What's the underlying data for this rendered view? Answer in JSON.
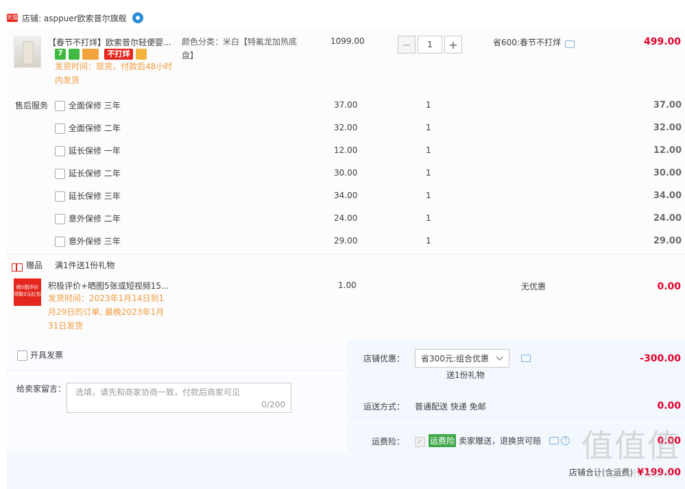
{
  "shop": {
    "badge": "天猫",
    "label": "店铺: asppuer欧索普尔旗舰"
  },
  "product": {
    "title": "【春节不打烊】欧索普尔轻便婴...",
    "badge_text": "不打烊",
    "badge_seven": "7",
    "ship_time": "发货时间：现货，付款后48小时内发货",
    "sku": "颜色分类：米白【特氟龙加热底盘】",
    "unit_price": "1099.00",
    "quantity": "1",
    "discount": "省600:春节不打烊",
    "total": "499.00"
  },
  "services": {
    "heading": "售后服务",
    "items": [
      {
        "label": "全面保修 三年",
        "price": "37.00",
        "qty": "1",
        "total": "37.00"
      },
      {
        "label": "全面保修 二年",
        "price": "32.00",
        "qty": "1",
        "total": "32.00"
      },
      {
        "label": "延长保修 一年",
        "price": "12.00",
        "qty": "1",
        "total": "12.00"
      },
      {
        "label": "延长保修 二年",
        "price": "30.00",
        "qty": "1",
        "total": "30.00"
      },
      {
        "label": "延长保修 三年",
        "price": "34.00",
        "qty": "1",
        "total": "34.00"
      },
      {
        "label": "意外保修 二年",
        "price": "24.00",
        "qty": "1",
        "total": "24.00"
      },
      {
        "label": "意外保修 三年",
        "price": "29.00",
        "qty": "1",
        "total": "29.00"
      }
    ]
  },
  "gift": {
    "label": "赠品",
    "rule": "满1件送1份礼物",
    "img_text": "晒5图评价 领取2元红包",
    "title": "积极评价+晒图5张或短视频15...",
    "ship_time": "发货时间：2023年1月14日到1月29日的订单, 最晚2023年1月31日发货",
    "price": "1.00",
    "discount": "无优惠",
    "total": "0.00"
  },
  "invoice": {
    "label": "开具发票"
  },
  "message": {
    "label": "给卖家留言：",
    "placeholder": "选填，请先和商家协商一致，付款后商家可见",
    "counter": "0/200"
  },
  "shop_discount": {
    "label": "店铺优惠：",
    "selected": "省300元:组合优惠",
    "note": "送1份礼物",
    "amount": "-300.00"
  },
  "shipping": {
    "label": "运送方式：",
    "value": "普通配送 快递 免邮",
    "amount": "0.00"
  },
  "insurance": {
    "label": "运费险：",
    "badge": "运费险",
    "text": "卖家赠送，退换货可赔",
    "amount": "0.00"
  },
  "footer": {
    "label": "店铺合计(含运费)",
    "total": "¥199.00"
  },
  "watermark": {
    "text": "值 zhi.smzdm.com",
    "logo": "值值值",
    "url": "zhizhizhi.com"
  },
  "colors": {
    "price_red": "#e4002b",
    "accent_blue": "#f3f8ff",
    "ship_orange": "#f09a3c",
    "insurance_green": "#3fa94a"
  }
}
